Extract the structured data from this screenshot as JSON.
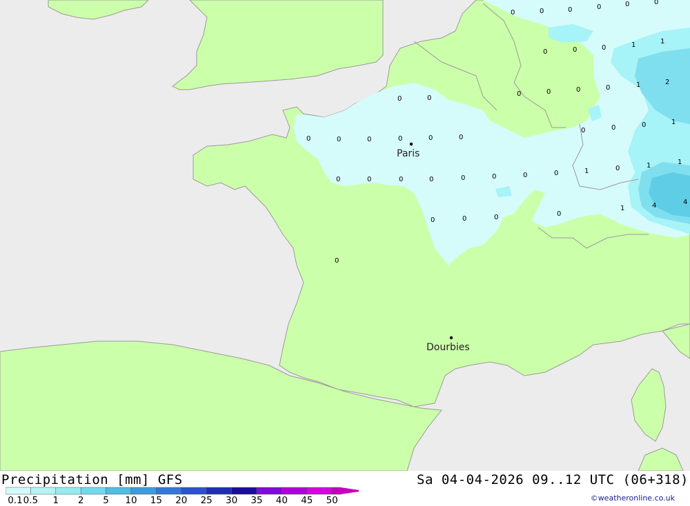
{
  "map": {
    "cities": [
      {
        "id": "paris",
        "name": "Paris"
      },
      {
        "id": "dourbies",
        "name": "Dourbies"
      }
    ],
    "values": [
      "0",
      "0",
      "0",
      "0",
      "0",
      "0",
      "0",
      "0",
      "0",
      "1",
      "1",
      "0",
      "0",
      "0",
      "0",
      "1",
      "2",
      "0",
      "0",
      "0",
      "0",
      "0",
      "0",
      "0",
      "0",
      "0",
      "0",
      "0",
      "1",
      "0",
      "0",
      "0",
      "0",
      "0",
      "0",
      "0",
      "0",
      "1",
      "0",
      "1",
      "1",
      "0",
      "0",
      "0",
      "1",
      "4",
      "4",
      "0",
      "0"
    ],
    "colors": {
      "land": "#ccffaa",
      "sea": "#ececec",
      "precip_light": "#d6fbfb",
      "precip_mid": "#a6f3f8",
      "precip_heavy": "#7fdfee"
    }
  },
  "footer": {
    "title": "Precipitation [mm] GFS",
    "datetime": "Sa 04-04-2026 09..12 UTC (06+318)",
    "credit": "©weatheronline.co.uk",
    "legend": {
      "labels": [
        "0.1",
        "0.5",
        "1",
        "2",
        "5",
        "10",
        "15",
        "20",
        "25",
        "30",
        "35",
        "40",
        "45",
        "50"
      ],
      "colors": [
        "#d3fbfb",
        "#b6f4f4",
        "#96ecf0",
        "#72d9ec",
        "#52bce2",
        "#3f9bd9",
        "#3676d9",
        "#2c51cf",
        "#1f2cbc",
        "#1a0c9a",
        "#7d0ae0",
        "#b100e0",
        "#d800e6",
        "#c600c0"
      ]
    }
  }
}
